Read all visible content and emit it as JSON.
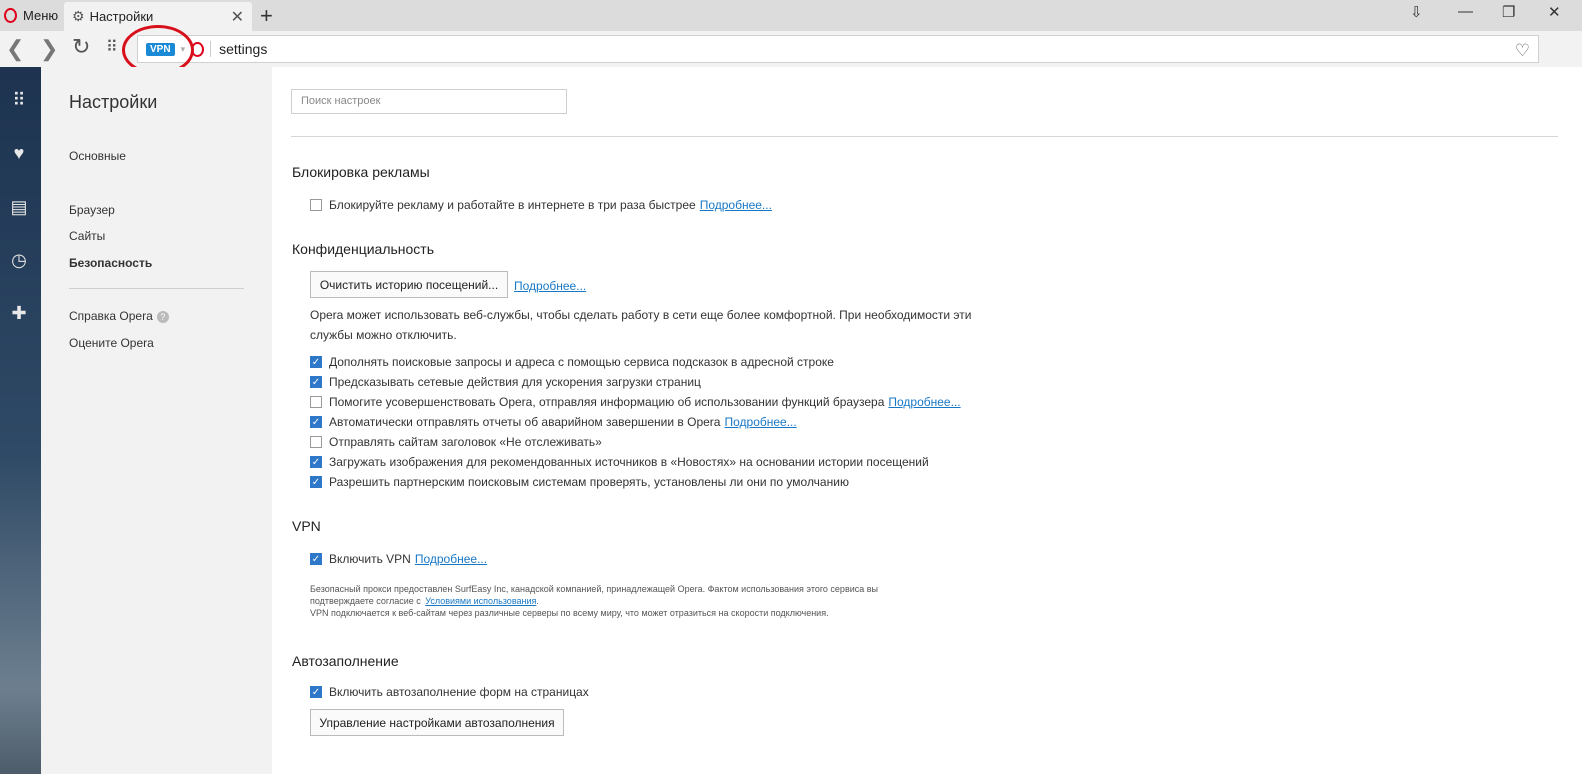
{
  "titlebar": {
    "menu_label": "Меню",
    "tab_title": "Настройки",
    "tab_close": "✕",
    "new_tab": "+",
    "controls": [
      "⇩",
      "—",
      "❐",
      "✕"
    ]
  },
  "navbar": {
    "back": "❮",
    "forward": "❯",
    "reload": "↻",
    "vpn_badge": "VPN",
    "url": "settings"
  },
  "sidebar_icons": [
    "speed-dial-icon",
    "heart-icon",
    "news-icon",
    "history-icon",
    "extensions-icon"
  ],
  "leftnav": {
    "title": "Настройки",
    "items": [
      "Основные",
      "Браузер",
      "Сайты",
      "Безопасность",
      "Справка Opera",
      "Оцените Opera"
    ]
  },
  "content": {
    "search_placeholder": "Поиск настроек",
    "adblock": {
      "heading": "Блокировка рекламы",
      "option": "Блокируйте рекламу и работайте в интернете в три раза быстрее",
      "more": "Подробнее..."
    },
    "privacy": {
      "heading": "Конфиденциальность",
      "clear_button": "Очистить историю посещений...",
      "more": "Подробнее...",
      "para1": "Opera может использовать веб-службы, чтобы сделать работу в сети еще более комфортной. При необходимости эти",
      "para2": "службы можно отключить.",
      "options": [
        {
          "label": "Дополнять поисковые запросы и адреса с помощью сервиса подсказок в адресной строке",
          "checked": true,
          "link": ""
        },
        {
          "label": "Предсказывать сетевые действия для ускорения загрузки страниц",
          "checked": true,
          "link": ""
        },
        {
          "label": "Помогите усовершенствовать Opera, отправляя информацию об использовании функций браузера",
          "checked": false,
          "link": "Подробнее..."
        },
        {
          "label": "Автоматически отправлять отчеты об аварийном завершении в Opera",
          "checked": true,
          "link": "Подробнее..."
        },
        {
          "label": "Отправлять сайтам заголовок «Не отслеживать»",
          "checked": false,
          "link": ""
        },
        {
          "label": "Загружать изображения для рекомендованных источников в «Новостях» на основании истории посещений",
          "checked": true,
          "link": ""
        },
        {
          "label": "Разрешить партнерским поисковым системам проверять, установлены ли они по умолчанию",
          "checked": true,
          "link": ""
        }
      ]
    },
    "vpn": {
      "heading": "VPN",
      "option": "Включить VPN",
      "more": "Подробнее...",
      "note1": "Безопасный прокси предоставлен SurfEasy Inc, канадской компанией, принадлежащей Opera. Фактом использования этого сервиса вы",
      "note2_prefix": "подтверждаете согласие с",
      "note2_link": "Условиями использования",
      "note3": "VPN подключается к веб-сайтам через различные серверы по всему миру, что может отразиться на скорости подключения."
    },
    "autofill": {
      "heading": "Автозаполнение",
      "option": "Включить автозаполнение форм на страницах",
      "manage_button": "Управление настройками автозаполнения"
    }
  }
}
